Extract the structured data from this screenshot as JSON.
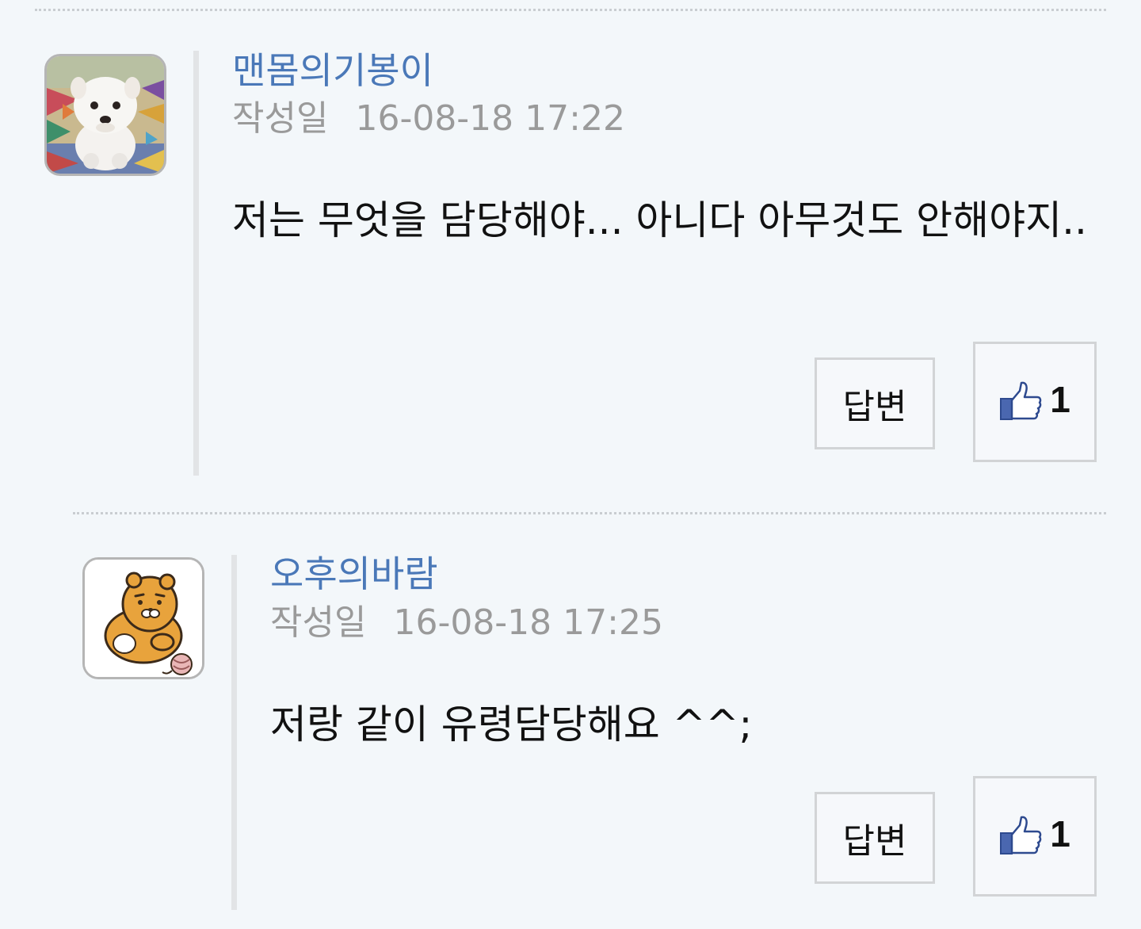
{
  "comments": [
    {
      "author": "맨몸의기봉이",
      "date_label": "작성일",
      "date": "16-08-18 17:22",
      "body": "저는 무엇을 담당해야... 아니다 아무것도 안해야지..",
      "reply_label": "답변",
      "likes": "1",
      "avatar_icon": "puppy-avatar"
    },
    {
      "author": "오후의바람",
      "date_label": "작성일",
      "date": "16-08-18 17:25",
      "body": "저랑 같이 유령담당해요 ^^;",
      "reply_label": "답변",
      "likes": "1",
      "avatar_icon": "lion-character-avatar"
    }
  ],
  "colors": {
    "author": "#4a78b8",
    "meta": "#9a9a9a",
    "background": "#f3f7fa",
    "thumb_blue": "#4a67b0"
  }
}
